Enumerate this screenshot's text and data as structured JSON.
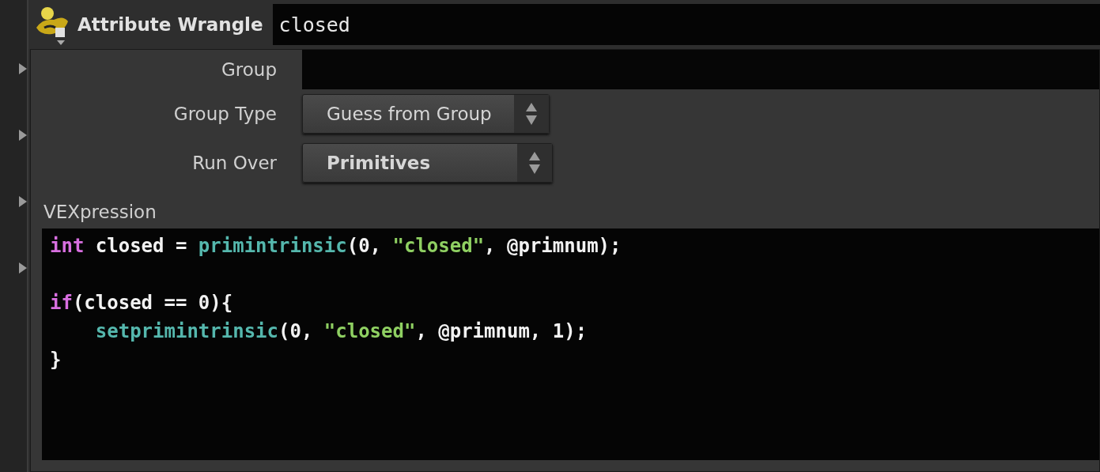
{
  "node": {
    "type_label": "Attribute Wrangle",
    "name": "closed"
  },
  "parameters": [
    {
      "kind": "field",
      "label": "Group"
    },
    {
      "kind": "menu",
      "label": "Group Type",
      "value": "Guess from Group",
      "modified": false
    },
    {
      "kind": "menu",
      "label": "Run Over",
      "value": "Primitives",
      "modified": true
    }
  ],
  "vexpression": {
    "label": "VEXpression",
    "blocks": [
      {
        "lines": [
          {
            "indented": false,
            "tokens": [
              {
                "kind": "keyword",
                "text": "int"
              },
              {
                "kind": "plain",
                "text": " closed = "
              },
              {
                "kind": "function",
                "text": "primintrinsic"
              },
              {
                "kind": "plain",
                "text": "(0, "
              },
              {
                "kind": "string",
                "text": "\"closed\""
              },
              {
                "kind": "plain",
                "text": ", @primnum);"
              }
            ]
          }
        ]
      },
      {
        "lines": [
          {
            "indented": false,
            "tokens": [
              {
                "kind": "keyword",
                "text": "if"
              },
              {
                "kind": "plain",
                "text": "(closed == 0){"
              }
            ]
          },
          {
            "indented": true,
            "tokens": [
              {
                "kind": "function",
                "text": "setprimintrinsic"
              },
              {
                "kind": "plain",
                "text": "(0, "
              },
              {
                "kind": "string",
                "text": "\"closed\""
              },
              {
                "kind": "plain",
                "text": ", @primnum, 1);"
              }
            ]
          },
          {
            "indented": false,
            "tokens": [
              {
                "kind": "plain",
                "text": "}"
              }
            ]
          }
        ]
      }
    ]
  }
}
